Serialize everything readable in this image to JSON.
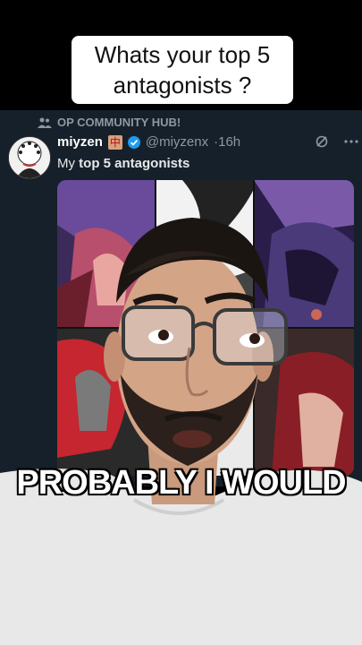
{
  "overlay": {
    "question": "Whats your top 5 antagonists ?",
    "caption": "PROBABLY I WOULD"
  },
  "post": {
    "community": "OP COMMUNITY HUB!",
    "author": "miyzen",
    "author_badge": "中",
    "handle": "@miyzenx",
    "time": "·16h",
    "text_prefix": "My ",
    "text_bold": "top 5 antagonists",
    "icons": [
      "people-icon",
      "verified-icon",
      "grok-icon",
      "more-icon"
    ]
  },
  "colors": {
    "tweet_bg": "#16202a",
    "muted": "#8b98a5",
    "verified": "#1d9bf0"
  }
}
